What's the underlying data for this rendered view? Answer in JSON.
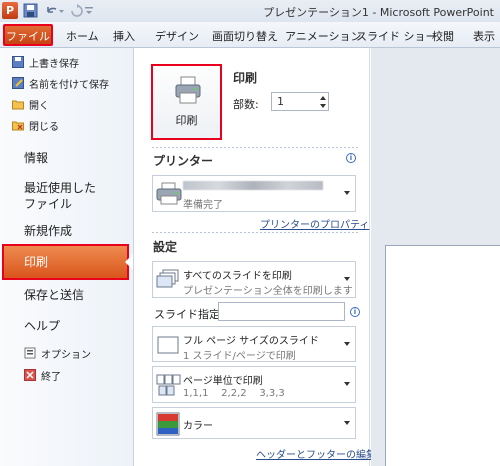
{
  "window": {
    "title": "プレゼンテーション1 - Microsoft PowerPoint",
    "app_logo": "P"
  },
  "ribbon": {
    "file_tab": "ファイル",
    "tabs": [
      "ホーム",
      "挿入",
      "デザイン",
      "画面切り替え",
      "アニメーション",
      "スライド ショー",
      "校閲",
      "表示"
    ]
  },
  "nav": {
    "overwrite_save": "上書き保存",
    "save_as": "名前を付けて保存",
    "open": "開く",
    "close": "閉じる",
    "info": "情報",
    "recent_line1": "最近使用した",
    "recent_line2": "ファイル",
    "new": "新規作成",
    "print": "印刷",
    "save_send": "保存と送信",
    "help": "ヘルプ",
    "options": "オプション",
    "exit": "終了"
  },
  "print": {
    "heading": "印刷",
    "button_label": "印刷",
    "copies_label": "部数:",
    "copies_value": "1"
  },
  "printer": {
    "heading": "プリンター",
    "status": "準備完了",
    "properties_link": "プリンターのプロパティ"
  },
  "settings": {
    "heading": "設定",
    "range_title": "すべてのスライドを印刷",
    "range_desc": "プレゼンテーション全体を印刷します",
    "slides_label": "スライド指定:",
    "layout_title": "フル ページ サイズのスライド",
    "layout_desc": "1 スライド/ページで印刷",
    "collate_title": "ページ単位で印刷",
    "collate_desc": "1,1,1    2,2,2    3,3,3",
    "color_title": "カラー",
    "header_footer_link": "ヘッダーとフッターの編集"
  }
}
